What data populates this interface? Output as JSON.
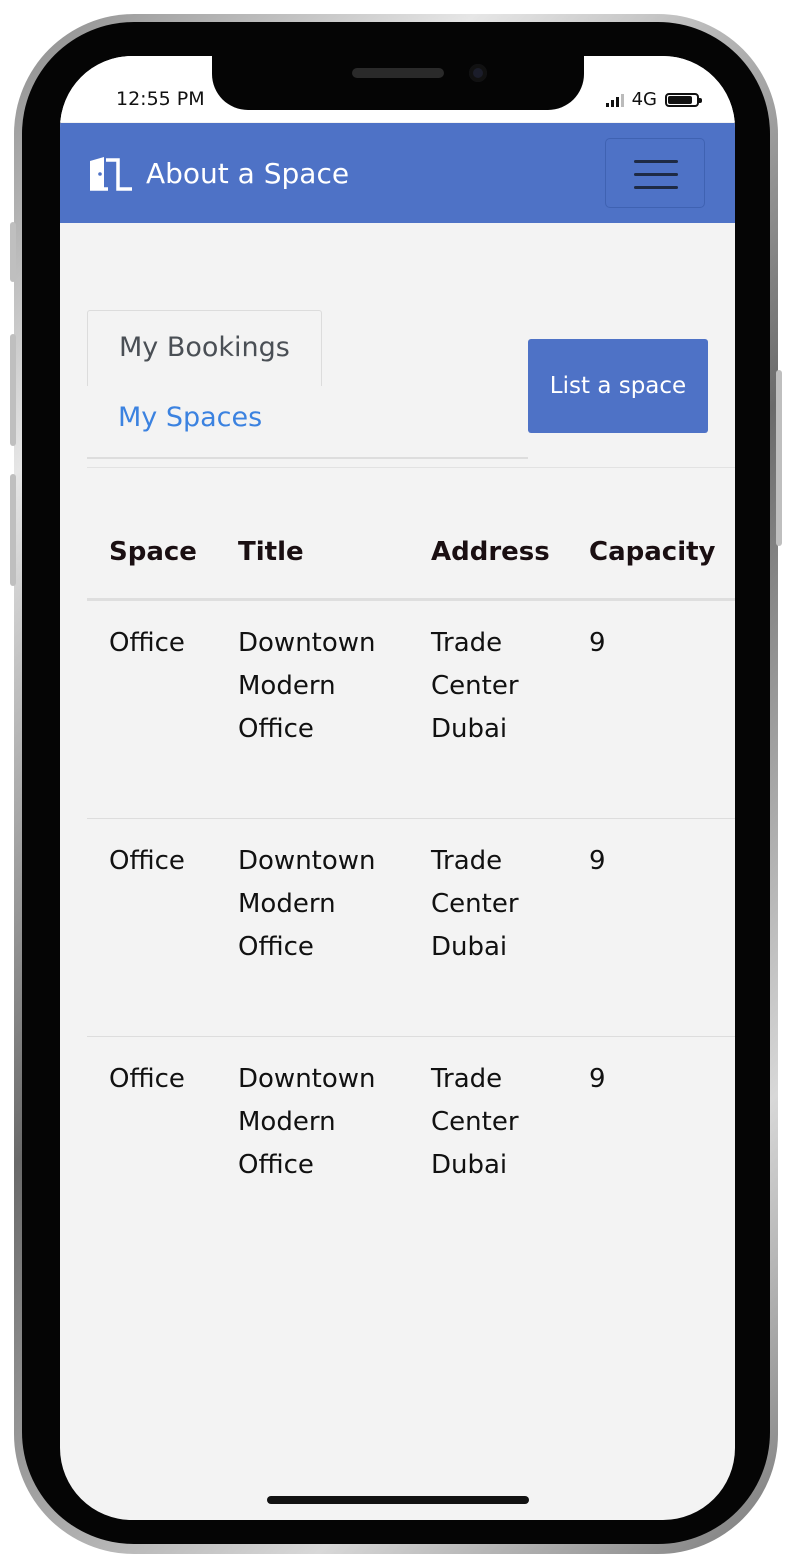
{
  "status_bar": {
    "time": "12:55 PM",
    "network": "4G"
  },
  "navbar": {
    "brand": "About a Space",
    "brand_icon": "door-icon",
    "menu_icon": "hamburger-icon"
  },
  "tabs": [
    {
      "label": "My Bookings",
      "active": true
    },
    {
      "label": "My Spaces",
      "active": false
    }
  ],
  "actions": {
    "list_space": "List a space"
  },
  "table": {
    "headers": [
      "Space",
      "Title",
      "Address",
      "Capacity"
    ],
    "rows": [
      {
        "space": "Office",
        "title": "Downtown\nModern\nOffice",
        "address": "Trade\nCenter\nDubai",
        "capacity": "9"
      },
      {
        "space": "Office",
        "title": "Downtown\nModern\nOffice",
        "address": "Trade\nCenter\nDubai",
        "capacity": "9"
      },
      {
        "space": "Office",
        "title": "Downtown\nModern\nOffice",
        "address": "Trade\nCenter\nDubai",
        "capacity": "9"
      }
    ]
  },
  "colors": {
    "brand": "#4e72c6",
    "link": "#3b82e0",
    "background": "#f3f3f3"
  }
}
